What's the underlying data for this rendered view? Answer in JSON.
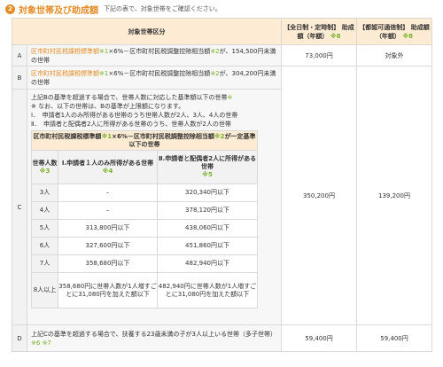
{
  "section": {
    "number": "2",
    "title": "対象世帯及び助成額",
    "note": "下記の表で、対象世帯をご確認ください。"
  },
  "table": {
    "col_header_category": "対象世帯区分",
    "col_header_fulltime": "【全日制・定時制】 助成額（年額）",
    "col_header_fulltime_mark": "※8",
    "col_header_correspondence": "【都認可通信制】 助成額（年額）",
    "col_header_correspondence_mark": "※8",
    "rows": [
      {
        "label": "A",
        "desc_orange": "区市町村民税課税標準額",
        "desc_green1": "※1",
        "desc_mid": "×6%－区市町村民税調整控除相当額",
        "desc_green2": "※2",
        "desc_end": "が、154,500円未満の世帯",
        "fulltime": "73,000円",
        "correspondence": "対象外"
      },
      {
        "label": "B",
        "desc_orange": "区市町村民税課税標準額",
        "desc_green1": "※1",
        "desc_mid": "×6%－区市町村民税調整控除相当額",
        "desc_green2": "※2",
        "desc_end": "が、304,200円未満の世帯",
        "fulltime": "",
        "correspondence": ""
      },
      {
        "label": "C",
        "intro1": "上記Bの基準を超過する場合で、世帯人数に対応した基準額以下の世帯",
        "intro1_mark": "※",
        "intro2": "※ なお、以下の世帯は、Bの基準が上限額になります。",
        "intro3": "Ⅰ．　申請者1人のみ所得がある世帯のうち世帯人数が2人、3人、4人の世帯",
        "intro4": "Ⅱ．　申請者と配偶者2人に所得がある世帯のうち、世帯人数が2人の世帯",
        "fulltime": "350,200円",
        "correspondence": "139,200円"
      },
      {
        "label": "D",
        "desc": "上記Cの基準を超過する場合で、扶養する23歳未満の子が3人以上いる世帯（多子世帯）",
        "mark1": "※6",
        "mark2": "※7",
        "fulltime": "59,400円",
        "correspondence": "59,400円"
      }
    ]
  },
  "inner_table": {
    "title_part1": "区市町村民税課税標準額",
    "title_m1": "※1",
    "title_part2": "×6%－区市町村民税調整控除相当額",
    "title_m2": "※2",
    "title_part3": "が一定基準以下の世帯",
    "col_count": "世帯人数",
    "col_count_mark": "※3",
    "col_one": "Ⅰ.申請者１人のみ所得がある世帯",
    "col_one_mark": "※4",
    "col_two": "Ⅱ.申請者と配偶者2人に所得がある世帯",
    "col_two_mark": "※5",
    "rows": [
      {
        "count": "3人",
        "one": "–",
        "two": "320,340円以下"
      },
      {
        "count": "4人",
        "one": "–",
        "two": "378,120円以下"
      },
      {
        "count": "5人",
        "one": "313,800円以下",
        "two": "438,060円以下"
      },
      {
        "count": "6人",
        "one": "327,600円以下",
        "two": "451,860円以下"
      },
      {
        "count": "7人",
        "one": "358,680円以下",
        "two": "482,940円以下"
      },
      {
        "count": "8人以上",
        "one": "358,680円に世帯人数が1人増すごとに31,080円を加えた額以下",
        "two": "482,940円に世帯人数が1人増すごとに31,080円を加えた額以下"
      }
    ]
  }
}
